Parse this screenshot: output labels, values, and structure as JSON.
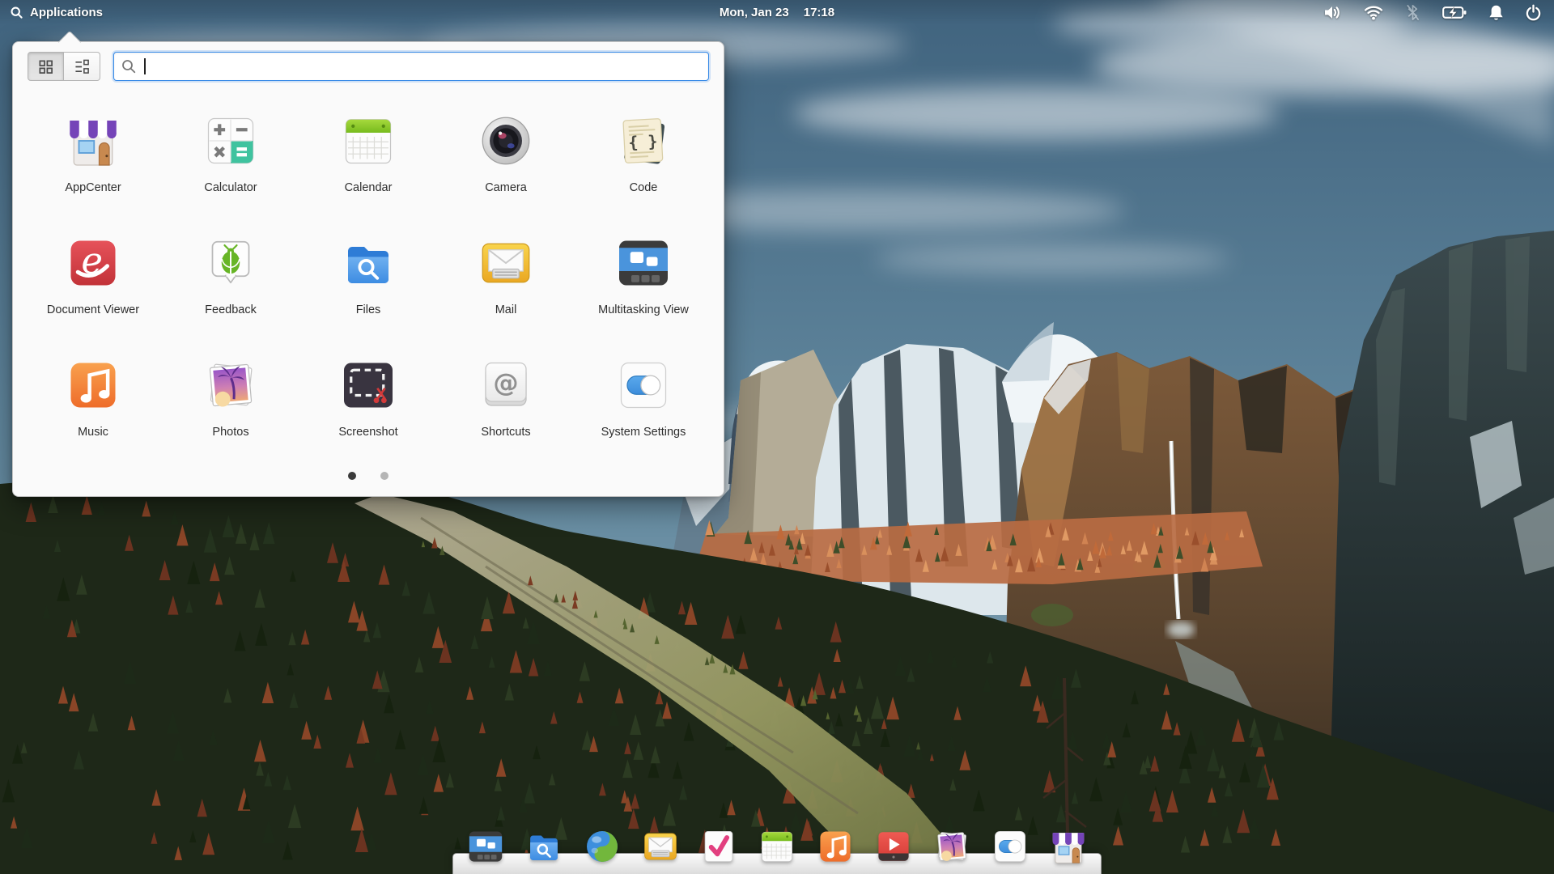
{
  "panel": {
    "applications_label": "Applications",
    "date": "Mon, Jan 23",
    "time": "17:18",
    "tray_icons": [
      "volume",
      "wifi",
      "bluetooth-disabled",
      "battery-charging",
      "notifications-bell",
      "power"
    ]
  },
  "launcher": {
    "view_modes": [
      {
        "id": "grid",
        "label": "Grid view",
        "active": true
      },
      {
        "id": "list",
        "label": "List view",
        "active": false
      }
    ],
    "search": {
      "placeholder": "",
      "value": ""
    },
    "apps": [
      {
        "name": "AppCenter",
        "icon": "appcenter-icon"
      },
      {
        "name": "Calculator",
        "icon": "calculator-icon"
      },
      {
        "name": "Calendar",
        "icon": "calendar-icon"
      },
      {
        "name": "Camera",
        "icon": "camera-icon"
      },
      {
        "name": "Code",
        "icon": "code-icon"
      },
      {
        "name": "Document Viewer",
        "icon": "document-viewer-icon"
      },
      {
        "name": "Feedback",
        "icon": "feedback-icon"
      },
      {
        "name": "Files",
        "icon": "files-icon"
      },
      {
        "name": "Mail",
        "icon": "mail-icon"
      },
      {
        "name": "Multitasking View",
        "icon": "multitasking-view-icon"
      },
      {
        "name": "Music",
        "icon": "music-icon"
      },
      {
        "name": "Photos",
        "icon": "photos-icon"
      },
      {
        "name": "Screenshot",
        "icon": "screenshot-icon"
      },
      {
        "name": "Shortcuts",
        "icon": "shortcuts-icon"
      },
      {
        "name": "System Settings",
        "icon": "system-settings-icon"
      }
    ],
    "pagination": {
      "pages": 2,
      "active_page": 1
    }
  },
  "dock": {
    "items": [
      {
        "name": "Multitasking View",
        "icon": "multitasking-view-icon"
      },
      {
        "name": "Files",
        "icon": "files-icon"
      },
      {
        "name": "Web",
        "icon": "web-browser-icon"
      },
      {
        "name": "Mail",
        "icon": "mail-icon"
      },
      {
        "name": "Tasks",
        "icon": "tasks-icon"
      },
      {
        "name": "Calendar",
        "icon": "calendar-icon"
      },
      {
        "name": "Music",
        "icon": "music-icon"
      },
      {
        "name": "Videos",
        "icon": "videos-icon"
      },
      {
        "name": "Photos",
        "icon": "photos-icon"
      },
      {
        "name": "System Settings",
        "icon": "system-settings-icon"
      },
      {
        "name": "AppCenter",
        "icon": "appcenter-icon"
      }
    ]
  },
  "colors": {
    "accent": "#3689e6",
    "panel_text": "#ffffff",
    "label_text": "#2e2e2e",
    "popover_bg": "#fafafa"
  }
}
